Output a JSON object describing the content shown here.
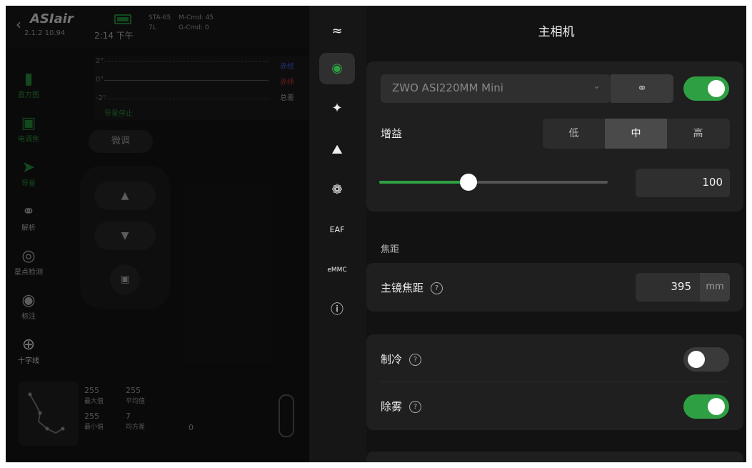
{
  "app": {
    "logo": "ASIair",
    "version": "2.1.2 10.94",
    "time": "2:14 下午",
    "status": {
      "line1a": "STA-65",
      "line1b": "M-Cmd: 45",
      "line2a": "7L",
      "line2b": "G-Cmd: 0"
    },
    "nav": [
      {
        "label": "直方图",
        "icon": "histogram-icon"
      },
      {
        "label": "电调焦",
        "icon": "focus-icon"
      },
      {
        "label": "导星",
        "icon": "guide-icon"
      },
      {
        "label": "解析",
        "icon": "globe-icon"
      },
      {
        "label": "星点检测",
        "icon": "star-detect-icon"
      },
      {
        "label": "标注",
        "icon": "annotate-icon"
      },
      {
        "label": "十字线",
        "icon": "crosshair-icon"
      }
    ],
    "graph": {
      "ytop": "2\"",
      "ymid": "0\"",
      "ybot": "-2\"",
      "legend_ra": "赤经",
      "legend_dec": "赤纬",
      "legend_total": "总差",
      "status": "导星停止"
    },
    "fine_tune": "微调",
    "stats": {
      "max_val": "255",
      "max_label": "最大值",
      "mean_val": "255",
      "mean_label": "平均值",
      "min_val": "255",
      "min_label": "最小值",
      "std_val": "7",
      "std_label": "均方差",
      "zero": "0"
    }
  },
  "panel": {
    "title": "主相机",
    "camera_select": "ZWO ASI220MM Mini",
    "camera_enabled": true,
    "gain_label": "增益",
    "gain_options": [
      "低",
      "中",
      "高"
    ],
    "gain_selected": "中",
    "gain_value": "100",
    "gain_fraction": 0.39,
    "focal_section": "焦距",
    "focal_label": "主镜焦距",
    "focal_value": "395",
    "focal_unit": "mm",
    "cooling_label": "制冷",
    "cooling_on": false,
    "dew_label": "除雾",
    "dew_on": true
  },
  "colors": {
    "accent": "#2ea043"
  }
}
